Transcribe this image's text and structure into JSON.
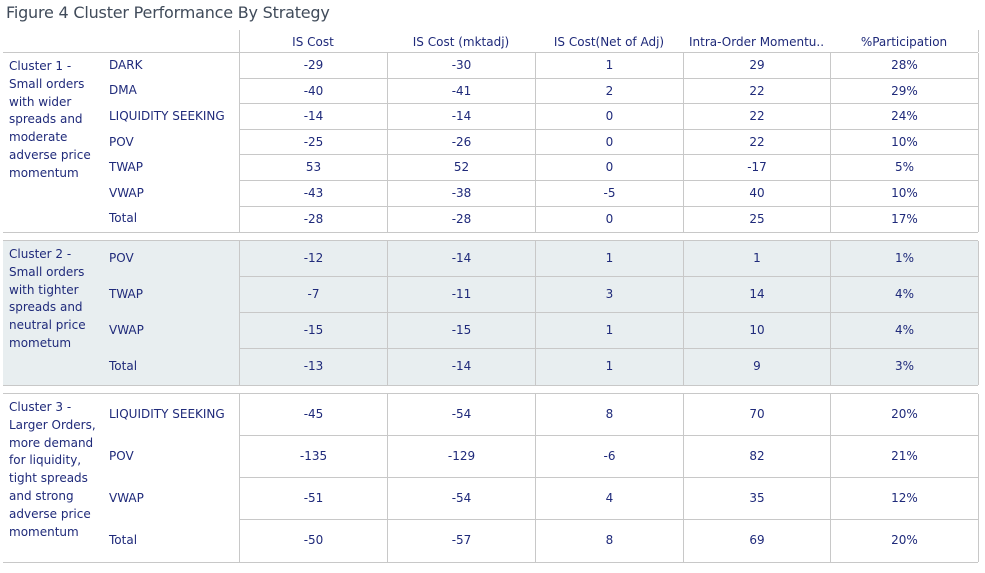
{
  "title": "Figure 4 Cluster Performance By Strategy",
  "chart_data": {
    "type": "table",
    "title": "Figure 4 Cluster Performance By Strategy",
    "columns": [
      "IS Cost",
      "IS Cost (mktadj)",
      "IS Cost(Net of Adj)",
      "Intra-Order Momentu..",
      "%Participation"
    ],
    "clusters": [
      {
        "label": "Cluster 1 - Small orders with wider spreads and moderate adverse price momentum",
        "rows": [
          {
            "strategy": "DARK",
            "values": [
              "-29",
              "-30",
              "1",
              "29",
              "28%"
            ]
          },
          {
            "strategy": "DMA",
            "values": [
              "-40",
              "-41",
              "2",
              "22",
              "29%"
            ]
          },
          {
            "strategy": "LIQUIDITY SEEKING",
            "values": [
              "-14",
              "-14",
              "0",
              "22",
              "24%"
            ]
          },
          {
            "strategy": "POV",
            "values": [
              "-25",
              "-26",
              "0",
              "22",
              "10%"
            ]
          },
          {
            "strategy": "TWAP",
            "values": [
              "53",
              "52",
              "0",
              "-17",
              "5%"
            ]
          },
          {
            "strategy": "VWAP",
            "values": [
              "-43",
              "-38",
              "-5",
              "40",
              "10%"
            ]
          },
          {
            "strategy": "Total",
            "values": [
              "-28",
              "-28",
              "0",
              "25",
              "17%"
            ]
          }
        ]
      },
      {
        "label": "Cluster 2 - Small orders with tighter spreads and neutral price mometum",
        "rows": [
          {
            "strategy": "POV",
            "values": [
              "-12",
              "-14",
              "1",
              "1",
              "1%"
            ]
          },
          {
            "strategy": "TWAP",
            "values": [
              "-7",
              "-11",
              "3",
              "14",
              "4%"
            ]
          },
          {
            "strategy": "VWAP",
            "values": [
              "-15",
              "-15",
              "1",
              "10",
              "4%"
            ]
          },
          {
            "strategy": "Total",
            "values": [
              "-13",
              "-14",
              "1",
              "9",
              "3%"
            ]
          }
        ]
      },
      {
        "label": "Cluster 3 - Larger Orders, more demand for liquidity, tight spreads and strong adverse price momentum",
        "rows": [
          {
            "strategy": "LIQUIDITY SEEKING",
            "values": [
              "-45",
              "-54",
              "8",
              "70",
              "20%"
            ]
          },
          {
            "strategy": "POV",
            "values": [
              "-135",
              "-129",
              "-6",
              "82",
              "21%"
            ]
          },
          {
            "strategy": "VWAP",
            "values": [
              "-51",
              "-54",
              "4",
              "35",
              "12%"
            ]
          },
          {
            "strategy": "Total",
            "values": [
              "-50",
              "-57",
              "8",
              "69",
              "20%"
            ]
          }
        ]
      }
    ]
  },
  "colors": {
    "text": "#1f2a7a",
    "shaded_band": "#e8eef0",
    "grid": "#c8c8c8"
  }
}
